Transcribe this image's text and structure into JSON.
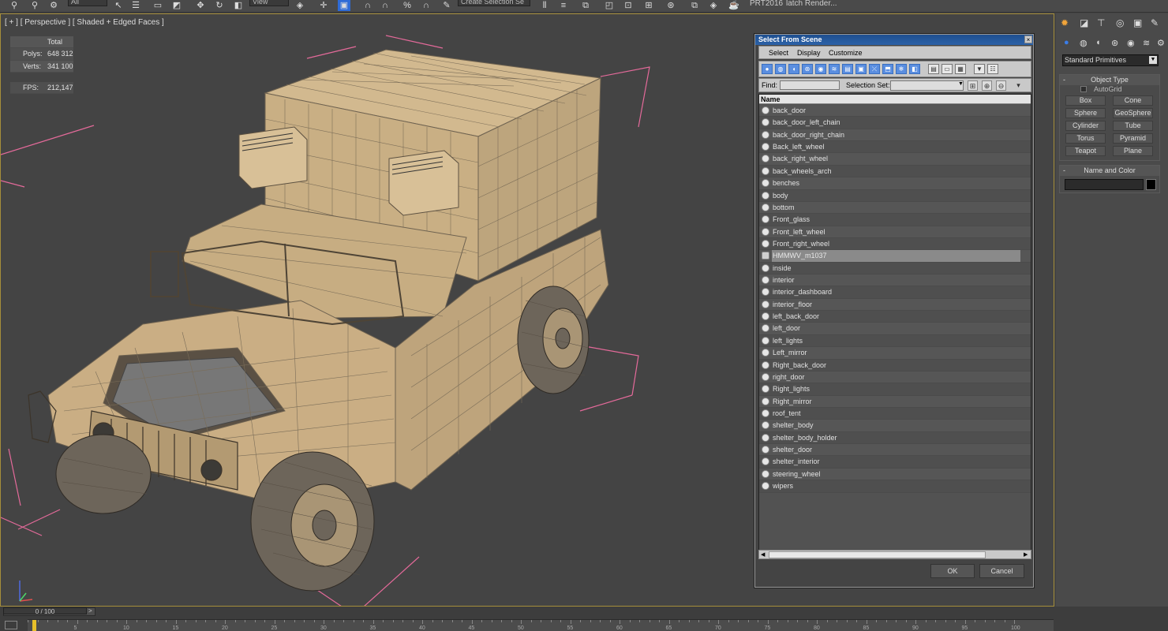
{
  "toolbar": {
    "selection_filter": "All",
    "ref_coord": "View",
    "named_selection_placeholder": "Create Selection Se",
    "prt_label": "PRT2016",
    "batch_render_label": "latch Render..."
  },
  "viewport": {
    "label": "[ + ] [ Perspective ] [ Shaded + Edged Faces ]",
    "stats": {
      "total_label": "Total",
      "polys_label": "Polys:",
      "polys_value": "648 312",
      "verts_label": "Verts:",
      "verts_value": "341 100",
      "fps_label": "FPS:",
      "fps_value": "212,147"
    },
    "colors": {
      "selection_bracket": "#e46a9a",
      "model": "#c8ad82",
      "wire": "#6e6250"
    }
  },
  "command_panel": {
    "dropdown_value": "Standard Primitives",
    "object_type": {
      "title": "Object Type",
      "autogrid_label": "AutoGrid",
      "buttons": [
        "Box",
        "Cone",
        "Sphere",
        "GeoSphere",
        "Cylinder",
        "Tube",
        "Torus",
        "Pyramid",
        "Teapot",
        "Plane"
      ]
    },
    "name_color": {
      "title": "Name and Color",
      "name_value": "",
      "color": "#000000"
    }
  },
  "dialog": {
    "title": "Select From Scene",
    "close_glyph": "×",
    "menu": [
      "Select",
      "Display",
      "Customize"
    ],
    "find_label": "Find:",
    "selection_set_label": "Selection Set:",
    "list_header": "Name",
    "items": [
      {
        "name": "back_door"
      },
      {
        "name": "back_door_left_chain"
      },
      {
        "name": "back_door_right_chain"
      },
      {
        "name": "Back_left_wheel"
      },
      {
        "name": "back_right_wheel"
      },
      {
        "name": "back_wheels_arch"
      },
      {
        "name": "benches"
      },
      {
        "name": "body"
      },
      {
        "name": "bottom"
      },
      {
        "name": "Front_glass"
      },
      {
        "name": "Front_left_wheel"
      },
      {
        "name": "Front_right_wheel"
      },
      {
        "name": "HMMWV_m1037",
        "selected": true
      },
      {
        "name": "inside"
      },
      {
        "name": "interior"
      },
      {
        "name": "interior_dashboard"
      },
      {
        "name": "interior_floor"
      },
      {
        "name": "left_back_door"
      },
      {
        "name": "left_door"
      },
      {
        "name": "left_lights"
      },
      {
        "name": "Left_mirror"
      },
      {
        "name": "Right_back_door"
      },
      {
        "name": "right_door"
      },
      {
        "name": "Right_lights"
      },
      {
        "name": "Right_mirror"
      },
      {
        "name": "roof_tent"
      },
      {
        "name": "shelter_body"
      },
      {
        "name": "shelter_body_holder"
      },
      {
        "name": "shelter_door"
      },
      {
        "name": "shelter_interior"
      },
      {
        "name": "steering_wheel"
      },
      {
        "name": "wipers"
      }
    ],
    "ok_label": "OK",
    "cancel_label": "Cancel"
  },
  "timeline": {
    "frame_label": "0 / 100",
    "next_glyph": ">",
    "ticks": [
      "5",
      "10",
      "15",
      "20",
      "25",
      "30",
      "35",
      "40",
      "45",
      "50",
      "55",
      "60",
      "65",
      "70",
      "75",
      "80",
      "85",
      "90",
      "95",
      "100"
    ]
  }
}
